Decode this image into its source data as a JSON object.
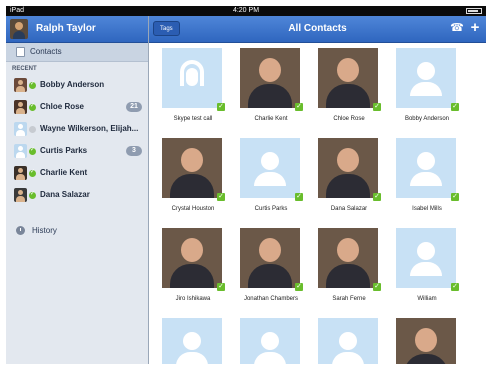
{
  "status": {
    "carrier": "iPad",
    "time": "4:20 PM"
  },
  "sidebar": {
    "user_name": "Ralph Taylor",
    "contacts_label": "Contacts",
    "recent_label": "RECENT",
    "recent": [
      {
        "name": "Bobby Anderson",
        "badge": "",
        "online": true
      },
      {
        "name": "Chloe Rose",
        "badge": "21",
        "online": true
      },
      {
        "name": "Wayne Wilkerson, Elijah...",
        "badge": "",
        "online": false
      },
      {
        "name": "Curtis Parks",
        "badge": "3",
        "online": true
      },
      {
        "name": "Charlie Kent",
        "badge": "",
        "online": true
      },
      {
        "name": "Dana Salazar",
        "badge": "",
        "online": true
      }
    ],
    "history_label": "History"
  },
  "main": {
    "tags_label": "Tags",
    "title": "All Contacts",
    "contacts": [
      {
        "name": "Skype test call",
        "kind": "headset"
      },
      {
        "name": "Charlie Kent",
        "kind": "photo"
      },
      {
        "name": "Chloe Rose",
        "kind": "photo"
      },
      {
        "name": "Bobby Anderson",
        "kind": "generic"
      },
      {
        "name": "Crystal Houston",
        "kind": "photo"
      },
      {
        "name": "Curtis Parks",
        "kind": "generic"
      },
      {
        "name": "Dana Salazar",
        "kind": "photo"
      },
      {
        "name": "Isabel Mills",
        "kind": "generic"
      },
      {
        "name": "Jiro Ishikawa",
        "kind": "photo"
      },
      {
        "name": "Jonathan Chambers",
        "kind": "photo"
      },
      {
        "name": "Sarah Ferne",
        "kind": "photo"
      },
      {
        "name": "William",
        "kind": "generic"
      },
      {
        "name": "",
        "kind": "generic"
      },
      {
        "name": "",
        "kind": "generic"
      },
      {
        "name": "",
        "kind": "generic"
      },
      {
        "name": "",
        "kind": "photo"
      }
    ]
  },
  "colors": {
    "header_blue": "#3b72c8",
    "online_green": "#69bd2c",
    "placeholder_blue": "#c8e1f5"
  }
}
